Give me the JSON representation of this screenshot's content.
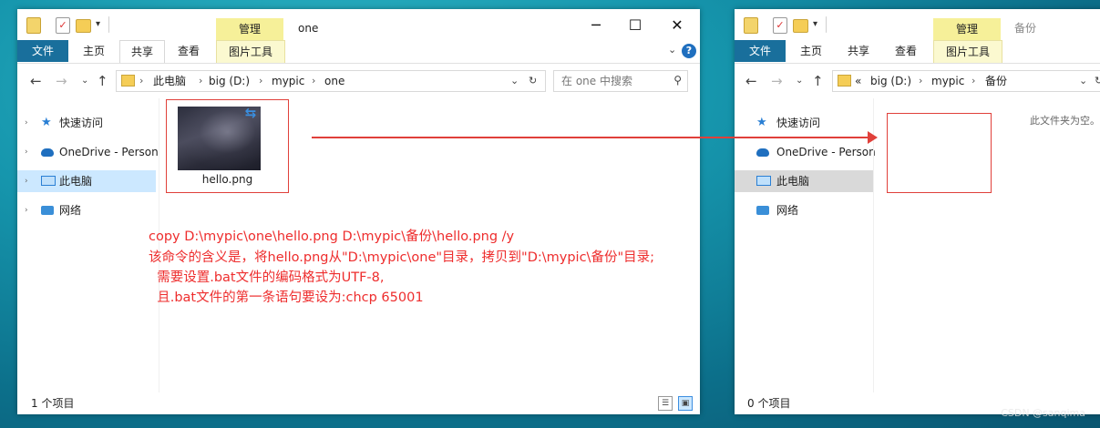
{
  "left_window": {
    "title": "one",
    "manage_tab": "管理",
    "ribbon_tabs": [
      "文件",
      "主页",
      "共享",
      "查看",
      "图片工具"
    ],
    "controls": {
      "minimize": "─",
      "maximize": "☐",
      "close": "✕"
    },
    "breadcrumb": [
      "此电脑",
      "big (D:)",
      "mypic",
      "one"
    ],
    "search_placeholder": "在 one 中搜索",
    "nav": [
      "快速访问",
      "OneDrive - Person",
      "此电脑",
      "网络"
    ],
    "file": {
      "name": "hello.png"
    },
    "status": "1 个项目"
  },
  "right_window": {
    "title": "备份",
    "manage_tab": "管理",
    "ribbon_tabs": [
      "文件",
      "主页",
      "共享",
      "查看",
      "图片工具"
    ],
    "breadcrumb_prefix": "«",
    "breadcrumb": [
      "big (D:)",
      "mypic",
      "备份"
    ],
    "nav": [
      "快速访问",
      "OneDrive - Person",
      "此电脑",
      "网络"
    ],
    "empty_message": "此文件夹为空。",
    "status": "0 个项目"
  },
  "annotation": {
    "lines": [
      "copy D:\\mypic\\one\\hello.png D:\\mypic\\备份\\hello.png /y",
      "该命令的含义是，将hello.png从\"D:\\mypic\\one\"目录，拷贝到\"D:\\mypic\\备份\"目录;",
      "  需要设置.bat文件的编码格式为UTF-8,",
      "  且.bat文件的第一条语句要设为:chcp 65001"
    ],
    "color": "#ee2d2d"
  },
  "watermark": "CSDN @sanqima"
}
